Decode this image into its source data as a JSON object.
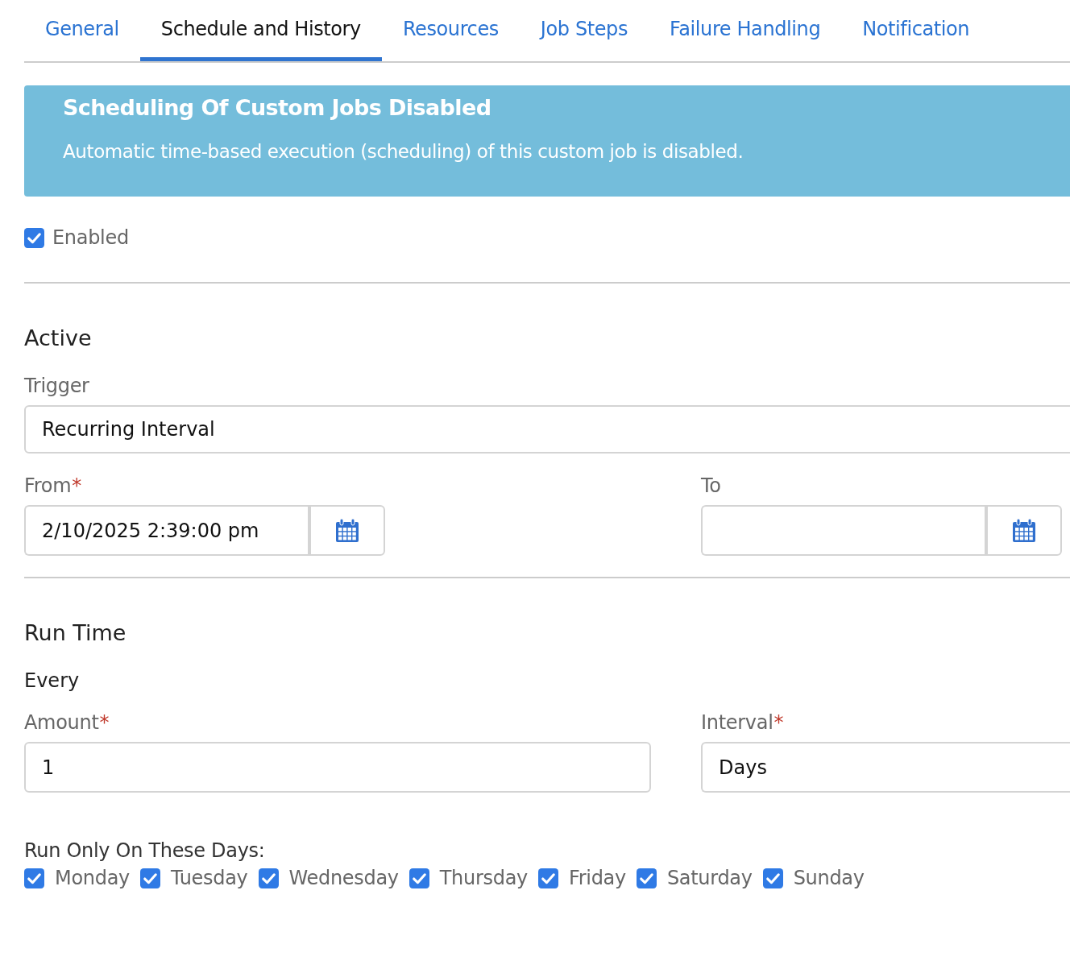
{
  "tabs": [
    {
      "label": "General",
      "selected": false
    },
    {
      "label": "Schedule and History",
      "selected": true
    },
    {
      "label": "Resources",
      "selected": false
    },
    {
      "label": "Job Steps",
      "selected": false
    },
    {
      "label": "Failure Handling",
      "selected": false
    },
    {
      "label": "Notification",
      "selected": false
    }
  ],
  "banner": {
    "title": "Scheduling Of Custom Jobs Disabled",
    "message": "Automatic time-based execution (scheduling) of this custom job is disabled."
  },
  "enabled": {
    "label": "Enabled",
    "checked": true
  },
  "active": {
    "heading": "Active",
    "trigger": {
      "label": "Trigger",
      "value": "Recurring Interval"
    },
    "from": {
      "label": "From",
      "required_mark": "*",
      "value": "2/10/2025 2:39:00 pm"
    },
    "to": {
      "label": "To"
    }
  },
  "run_time": {
    "heading": "Run Time",
    "subheading": "Every",
    "amount": {
      "label": "Amount",
      "required_mark": "*",
      "value": "1"
    },
    "interval": {
      "label": "Interval",
      "required_mark": "*",
      "value": "Days"
    },
    "days_label": "Run Only On These Days:",
    "days": [
      {
        "label": "Monday",
        "checked": true
      },
      {
        "label": "Tuesday",
        "checked": true
      },
      {
        "label": "Wednesday",
        "checked": true
      },
      {
        "label": "Thursday",
        "checked": true
      },
      {
        "label": "Friday",
        "checked": true
      },
      {
        "label": "Saturday",
        "checked": true
      },
      {
        "label": "Sunday",
        "checked": true
      }
    ]
  }
}
